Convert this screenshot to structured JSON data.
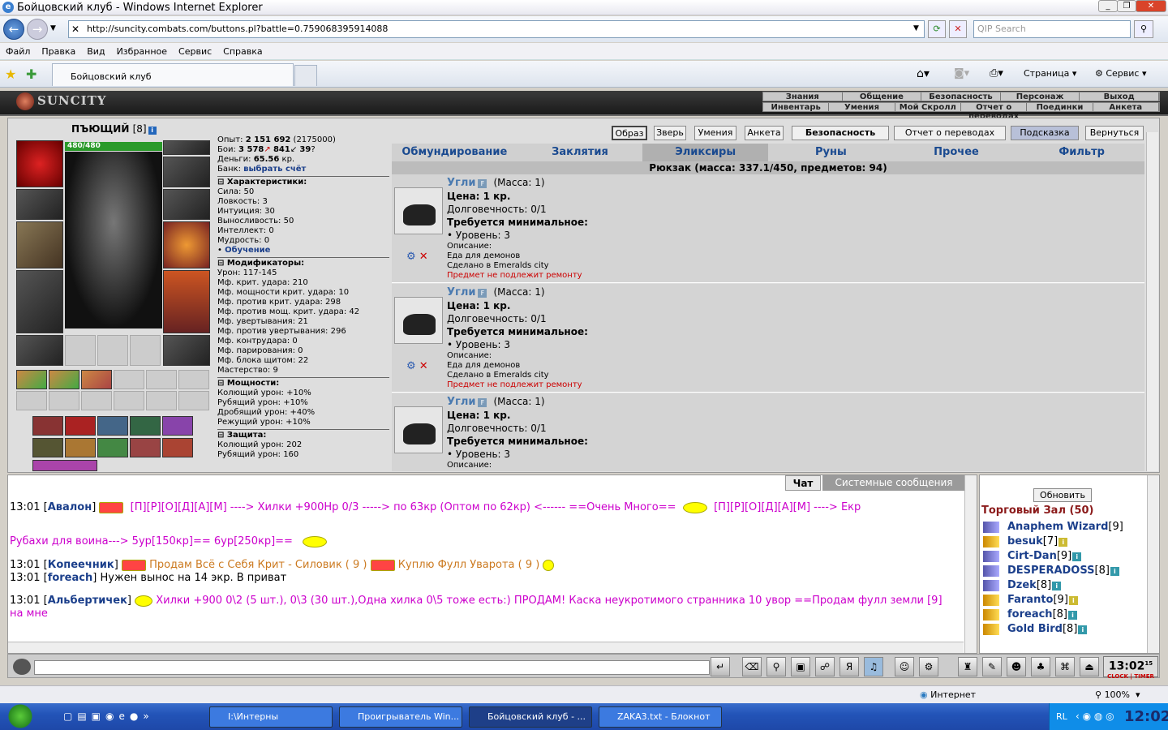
{
  "window": {
    "title": "Бойцовский клуб - Windows Internet Explorer"
  },
  "address": {
    "url": "http://suncity.combats.com/buttons.pl?battle=0.759068395914088",
    "search_placeholder": "QIP Search"
  },
  "menu": [
    "Файл",
    "Правка",
    "Вид",
    "Избранное",
    "Сервис",
    "Справка"
  ],
  "tabs": {
    "active": "Бойцовский клуб",
    "toolbar": [
      "Страница",
      "Сервис"
    ]
  },
  "game": {
    "logo": "SUNCITY",
    "top_links_row1": [
      "Знания",
      "Общение",
      "Безопасность",
      "Персонаж",
      "Выход"
    ],
    "top_links_row2": [
      "Инвентарь",
      "Умения",
      "Мой Скролл",
      "Отчет о переводах",
      "Поединки",
      "Анкета"
    ],
    "char": {
      "name": "ПЪЮЩИЙ",
      "level": "[8]",
      "hp": "480/480"
    },
    "stats": {
      "exp_label": "Опыт:",
      "exp": "2 151 692",
      "exp_next": "(2175000)",
      "fights_label": "Бои:",
      "wins": "3 578",
      "losses": "841",
      "draws": "39",
      "money_label": "Деньги:",
      "money": "65.56",
      "money_unit": "кр.",
      "bank_label": "Банк:",
      "bank_link": "выбрать счёт",
      "char_section": "Характеристики:",
      "attrs": [
        "Сила: 50",
        "Ловкость: 3",
        "Интуиция: 30",
        "Выносливость: 50",
        "Интеллект: 0",
        "Мудрость: 0"
      ],
      "training": "Обучение",
      "mods_section": "Модификаторы:",
      "mods": [
        "Урон: 117-145",
        "Мф. крит. удара: 210",
        "Мф. мощности крит. удара: 10",
        "Мф. против крит. удара: 298",
        "Мф. против мощ. крит. удара: 42",
        "Мф. увертывания: 21",
        "Мф. против увертывания: 296",
        "Мф. контрудара: 0",
        "Мф. парирования: 0",
        "Мф. блока щитом: 22",
        "Мастерство: 9"
      ],
      "power_section": "Мощности:",
      "powers": [
        "Колющий урон: +10%",
        "Рубящий урон: +10%",
        "Дробящий урон: +40%",
        "Режущий урон: +10%"
      ],
      "defense_section": "Защита:",
      "defense": [
        "Колющий урон: 202",
        "Рубящий урон: 160"
      ]
    },
    "buttons": [
      "Образ",
      "Зверь",
      "Умения",
      "Анкета",
      "Безопасность",
      "Отчет о переводах",
      "Подсказка",
      "Вернуться"
    ],
    "categories": [
      "Обмундирование",
      "Заклятия",
      "Эликсиры",
      "Руны",
      "Прочее",
      "Фильтр"
    ],
    "selected_category": "Эликсиры",
    "bag_title": "Рюкзак (масса: 337.1/450, предметов: 94)",
    "items": [
      {
        "name": "Угли",
        "mass": "(Масса: 1)",
        "price": "Цена: 1 кр.",
        "durability": "Долговечность: 0/1",
        "req": "Требуется минимальное:",
        "level": "• Уровень: 3",
        "desc_label": "Описание:",
        "desc": "Еда для демонов",
        "made": "Сделано в Emeralds city",
        "repair": "Предмет не подлежит ремонту"
      },
      {
        "name": "Угли",
        "mass": "(Масса: 1)",
        "price": "Цена: 1 кр.",
        "durability": "Долговечность: 0/1",
        "req": "Требуется минимальное:",
        "level": "• Уровень: 3",
        "desc_label": "Описание:",
        "desc": "Еда для демонов",
        "made": "Сделано в Emeralds city",
        "repair": "Предмет не подлежит ремонту"
      },
      {
        "name": "Угли",
        "mass": "(Масса: 1)",
        "price": "Цена: 1 кр.",
        "durability": "Долговечность: 0/1",
        "req": "Требуется минимальное:",
        "level": "• Уровень: 3",
        "desc_label": "Описание:"
      }
    ]
  },
  "chat": {
    "tabs": [
      "Чат",
      "Системные сообщения"
    ],
    "lines": [
      {
        "time": "13:01",
        "nick": "Авалон",
        "text": "[П][Р][О][Д][А][М] ----> Хилки +900Hp 0/3 -----> по 63кр (Оптом по 62кр) <------ ==Очень Много==",
        "text2": "[П][Р][О][Д][А][М] ----> Екр"
      },
      {
        "text": "Рубахи для воина---> 5ур[150кр]== 6ур[250кр]=="
      },
      {
        "time": "13:01",
        "nick": "Копеечник",
        "text": "Продам Всё с Себя Крит - Силовик ( 9 )",
        "text2": "Куплю Фулл Уварота ( 9 )"
      },
      {
        "time": "13:01",
        "nick": "foreach",
        "text": "Нужен вынос на 14 экр. В приват"
      },
      {
        "time": "13:01",
        "nick": "Альбертичек",
        "text": "Хилки +900 0\\2 (5 шт.), 0\\3 (30 шт.),Одна хилка 0\\5 тоже есть:) ПРОДАМ! Каска неукротимого странника 10 увор ==Продам фулл земли [9]",
        "text3": "на мне"
      }
    ]
  },
  "online": {
    "refresh": "Обновить",
    "room": "Торговый Зал (50)",
    "users": [
      {
        "name": "Anaphem Wizard",
        "level": "[9]"
      },
      {
        "name": "besuk",
        "level": "[7]"
      },
      {
        "name": "Cirt-Dan",
        "level": "[9]"
      },
      {
        "name": "DESPERADOSS",
        "level": "[8]"
      },
      {
        "name": "Dzek",
        "level": "[8]"
      },
      {
        "name": "Faranto",
        "level": "[9]"
      },
      {
        "name": "foreach",
        "level": "[8]"
      },
      {
        "name": "Gold Bird",
        "level": "[8]"
      }
    ]
  },
  "clock": {
    "time": "13:02",
    "sec": "15",
    "label": "CLOCK",
    "label2": "TIMER"
  },
  "statusbar": {
    "zone": "Интернет",
    "zoom": "100%"
  },
  "taskbar": {
    "tasks": [
      "I:\\Интерны",
      "Проигрыватель Win...",
      "Бойцовский клуб - ...",
      "ZAKA3.txt - Блокнот"
    ],
    "lang": "RL",
    "time": "12:02"
  }
}
